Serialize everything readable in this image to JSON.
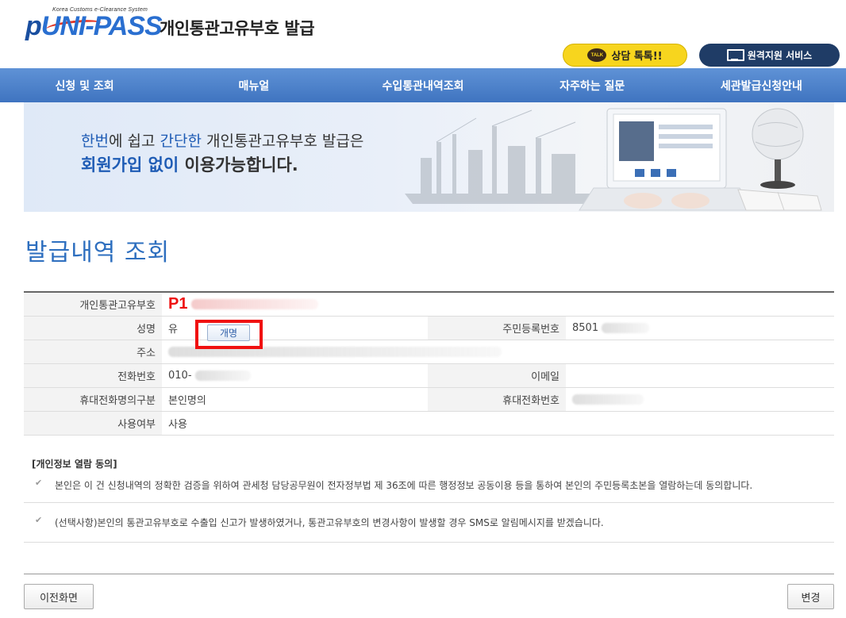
{
  "header": {
    "logo_sub": "Korea Customs e-Clearance System",
    "logo_p": "p",
    "logo_rest": "UNI-PASS",
    "site_title": "개인통관고유부호 발급",
    "talk_icon": "TALK",
    "talk_label": "상담 톡톡!!",
    "remote_label": "원격지원 서비스"
  },
  "nav": {
    "items": [
      "신청 및 조회",
      "매뉴얼",
      "수입통관내역조회",
      "자주하는 질문",
      "세관발급신청안내"
    ]
  },
  "banner": {
    "line1_pre": "한번",
    "line1_mid1": "에 쉽고 ",
    "line1_hl": "간단한",
    "line1_post": " 개인통관고유부호 발급은",
    "line2_hl": "회원가입 없이",
    "line2_post": " 이용가능합니다."
  },
  "page_title": "발급내역 조회",
  "info": {
    "tcn_label": "개인통관고유부호",
    "tcn_value": "P1",
    "name_label": "성명",
    "name_value": "유",
    "rename_button": "개명",
    "rrn_label": "주민등록번호",
    "rrn_value": "8501",
    "address_label": "주소",
    "phone_label": "전화번호",
    "phone_value": "010-",
    "email_label": "이메일",
    "mobile_owner_label": "휴대전화명의구분",
    "mobile_owner_value": "본인명의",
    "mobile_label": "휴대전화번호",
    "usage_label": "사용여부",
    "usage_value": "사용"
  },
  "consent": {
    "title": "[개인정보 열람 동의]",
    "item1": "본인은 이 건 신청내역의 정확한 검증을 위하여 관세청 담당공무원이 전자정부법 제 36조에 따른 행정정보 공동이용 등을 통하여 본인의 주민등록초본을 열람하는데 동의합니다.",
    "item2": "(선택사항)본인의 통관고유부호로 수출입 신고가 발생하였거나, 통관고유부호의 변경사항이 발생할 경우 SMS로 알림메시지를 받겠습니다."
  },
  "buttons": {
    "prev": "이전화면",
    "change": "변경"
  },
  "colors": {
    "nav_bg": "#4a7fc8",
    "title_blue": "#2e6fbf",
    "highlight_red": "#f01010",
    "talk_yellow": "#f7d51e",
    "remote_navy": "#1f3c66"
  },
  "icons": [
    "talk-icon",
    "monitor-icon",
    "checkbox-checked-icon"
  ]
}
